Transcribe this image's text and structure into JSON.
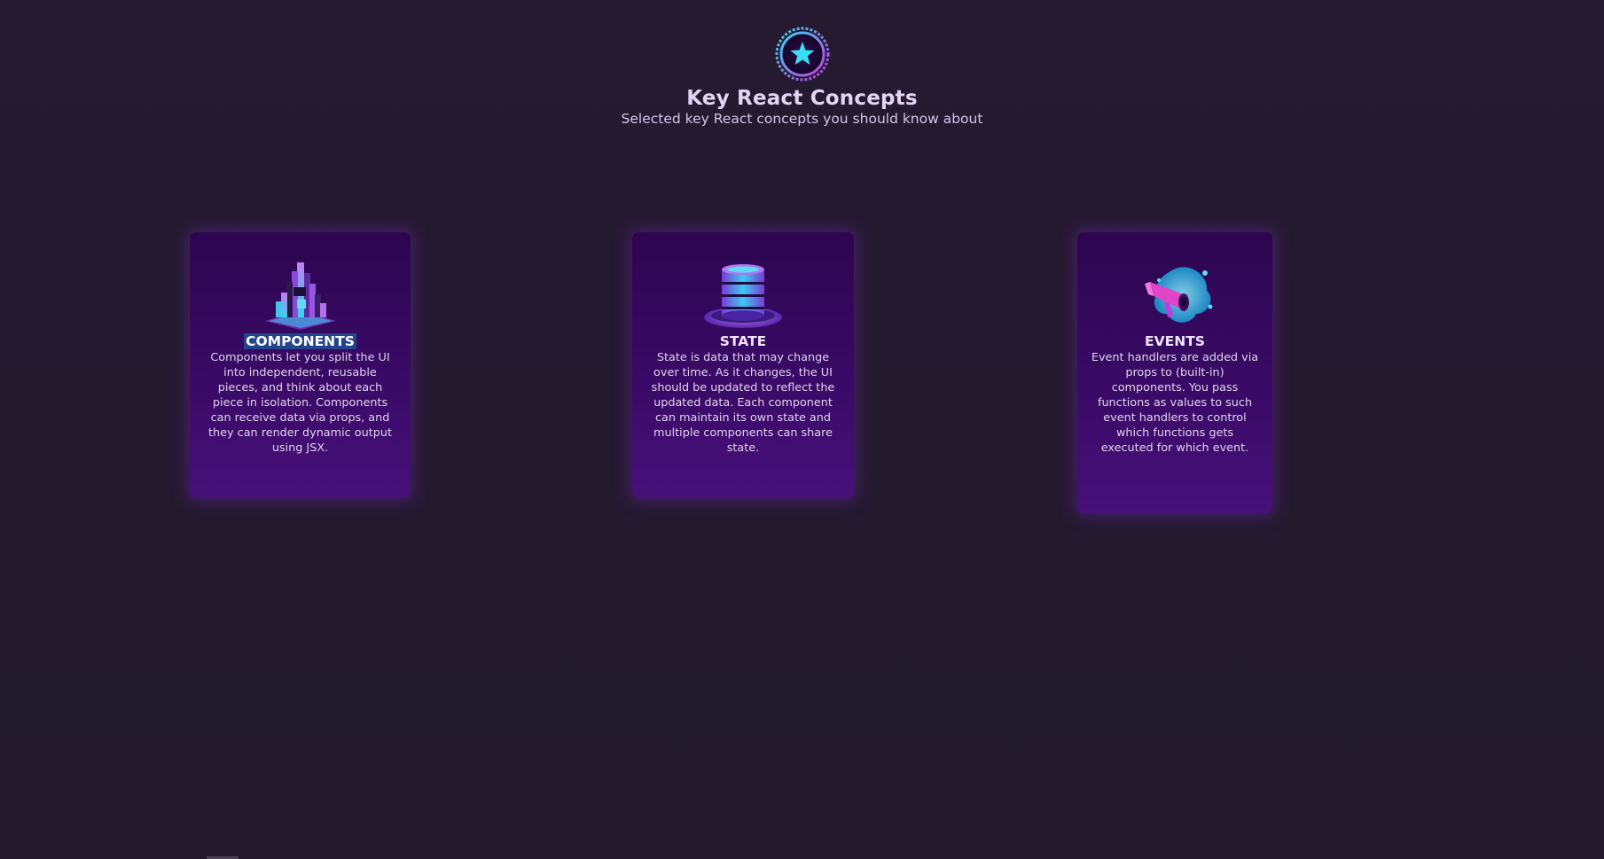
{
  "header": {
    "logo_icon": "star-badge-icon",
    "title": "Key React Concepts",
    "subtitle": "Selected key React concepts you should know about"
  },
  "concepts": [
    {
      "icon": "stacked-blocks-pyramid-icon",
      "title": "COMPONENTS",
      "description": "Components let you split the UI into independent, reusable pieces, and think about each piece in isolation. Components can receive data via props, and they can render dynamic output using JSX."
    },
    {
      "icon": "database-cylinder-icon",
      "title": "STATE",
      "description": "State is data that may change over time. As it changes, the UI should be updated to reflect the updated data. Each component can maintain its own state and multiple components can share state."
    },
    {
      "icon": "megaphone-splash-icon",
      "title": "EVENTS",
      "description": "Event handlers are added via props to (built-in) components. You pass functions as values to such event handlers to control which functions gets executed for which event."
    }
  ],
  "colors": {
    "background": "#231a2e",
    "card_top": "#2c0650",
    "card_bottom": "#47107a",
    "accent_cyan": "#34d7f0",
    "accent_magenta": "#c23be0",
    "selection": "#24448c"
  }
}
